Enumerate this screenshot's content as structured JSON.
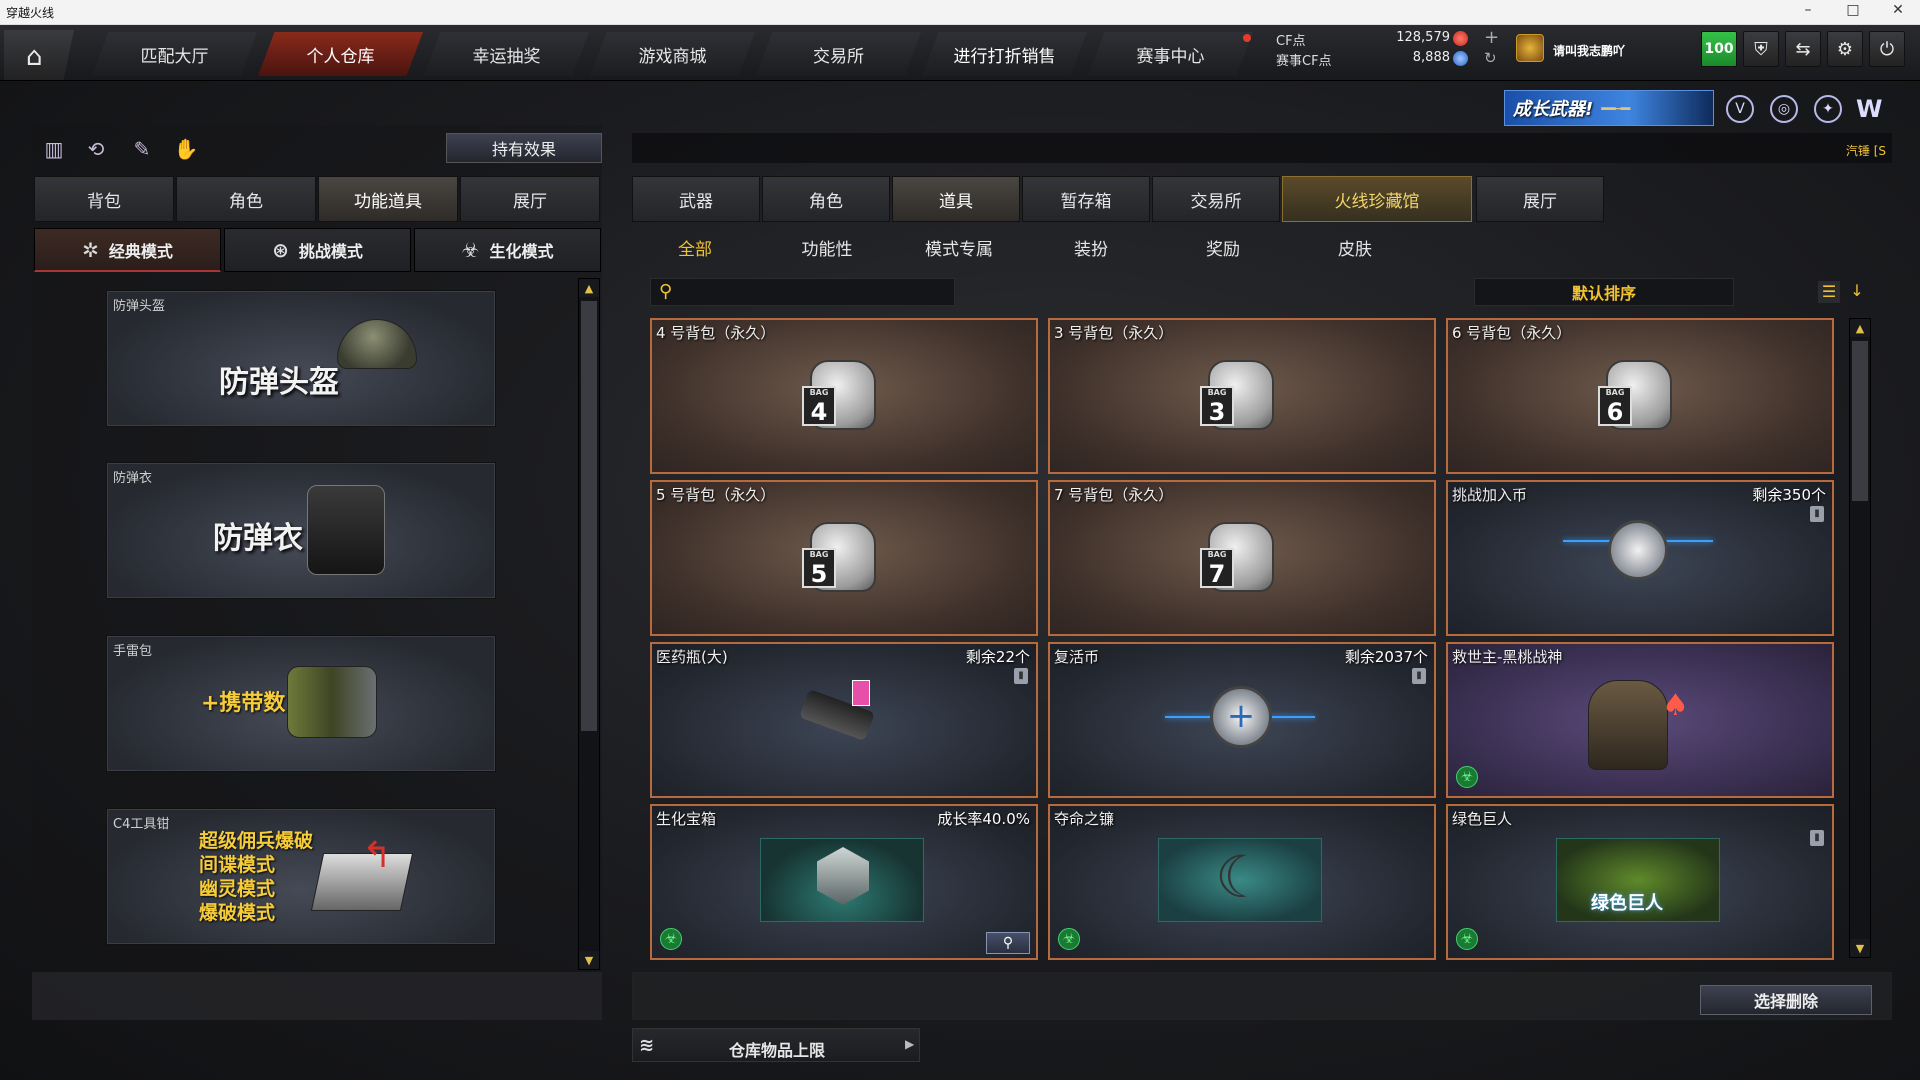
{
  "window": {
    "title": "穿越火线",
    "min": "–",
    "max": "□",
    "close": "✕"
  },
  "nav": {
    "home_icon": "home-icon",
    "tabs": [
      "匹配大厅",
      "个人仓库",
      "幸运抽奖",
      "游戏商城",
      "交易所",
      "进行打折销售",
      "赛事中心"
    ],
    "active": "个人仓库"
  },
  "currency": {
    "cf_label": "CF点",
    "cf_value": "128,579",
    "event_label": "赛事CF点",
    "event_value": "8,888"
  },
  "user": {
    "name": "请叫我志鹏吖",
    "level": "100"
  },
  "promo": {
    "banner": "成长武器!",
    "ticker": "汽锤 [S"
  },
  "left": {
    "effect_button": "持有效果",
    "tabs": [
      "背包",
      "角色",
      "功能道具",
      "展厅"
    ],
    "active_tab": "功能道具",
    "modes": [
      "经典模式",
      "挑战模式",
      "生化模式"
    ],
    "active_mode": "经典模式",
    "items": [
      {
        "caption": "防弹头盔",
        "title": "防弹头盔"
      },
      {
        "caption": "防弹衣",
        "title": "防弹衣"
      },
      {
        "caption": "手雷包",
        "title": "+携带数"
      },
      {
        "caption": "C4工具钳",
        "lines": [
          "超级佣兵爆破",
          "间谍模式",
          "幽灵模式",
          "爆破模式"
        ]
      }
    ]
  },
  "right": {
    "tabs": [
      "武器",
      "角色",
      "道具",
      "暂存箱",
      "交易所",
      "火线珍藏馆",
      "展厅"
    ],
    "active_tab": "道具",
    "subtabs": [
      "全部",
      "功能性",
      "模式专属",
      "装扮",
      "奖励",
      "皮肤"
    ],
    "active_subtab": "全部",
    "search_placeholder": "",
    "sort_label": "默认排序",
    "items": [
      {
        "name": "4 号背包（永久）",
        "bag": "4"
      },
      {
        "name": "3 号背包（永久）",
        "bag": "3"
      },
      {
        "name": "6 号背包（永久）",
        "bag": "6"
      },
      {
        "name": "5 号背包（永久）",
        "bag": "5"
      },
      {
        "name": "7 号背包（永久）",
        "bag": "7"
      },
      {
        "name": "挑战加入币",
        "right": "剩余350个"
      },
      {
        "name": "医药瓶(大)",
        "right": "剩余22个"
      },
      {
        "name": "复活币",
        "right": "剩余2037个"
      },
      {
        "name": "救世主-黑桃战神"
      },
      {
        "name": "生化宝箱",
        "right": "成长率40.0%"
      },
      {
        "name": "夺命之镰"
      },
      {
        "name": "绿色巨人",
        "pic_text": "绿色巨人"
      }
    ],
    "bag_word": "BAG",
    "delete_button": "选择删除",
    "capacity_label": "仓库物品上限"
  },
  "colors": {
    "accent_gold": "#f1c232",
    "card_border": "#b66a3d",
    "level_green": "#2bb33f",
    "active_red": "#8a2a1a"
  }
}
